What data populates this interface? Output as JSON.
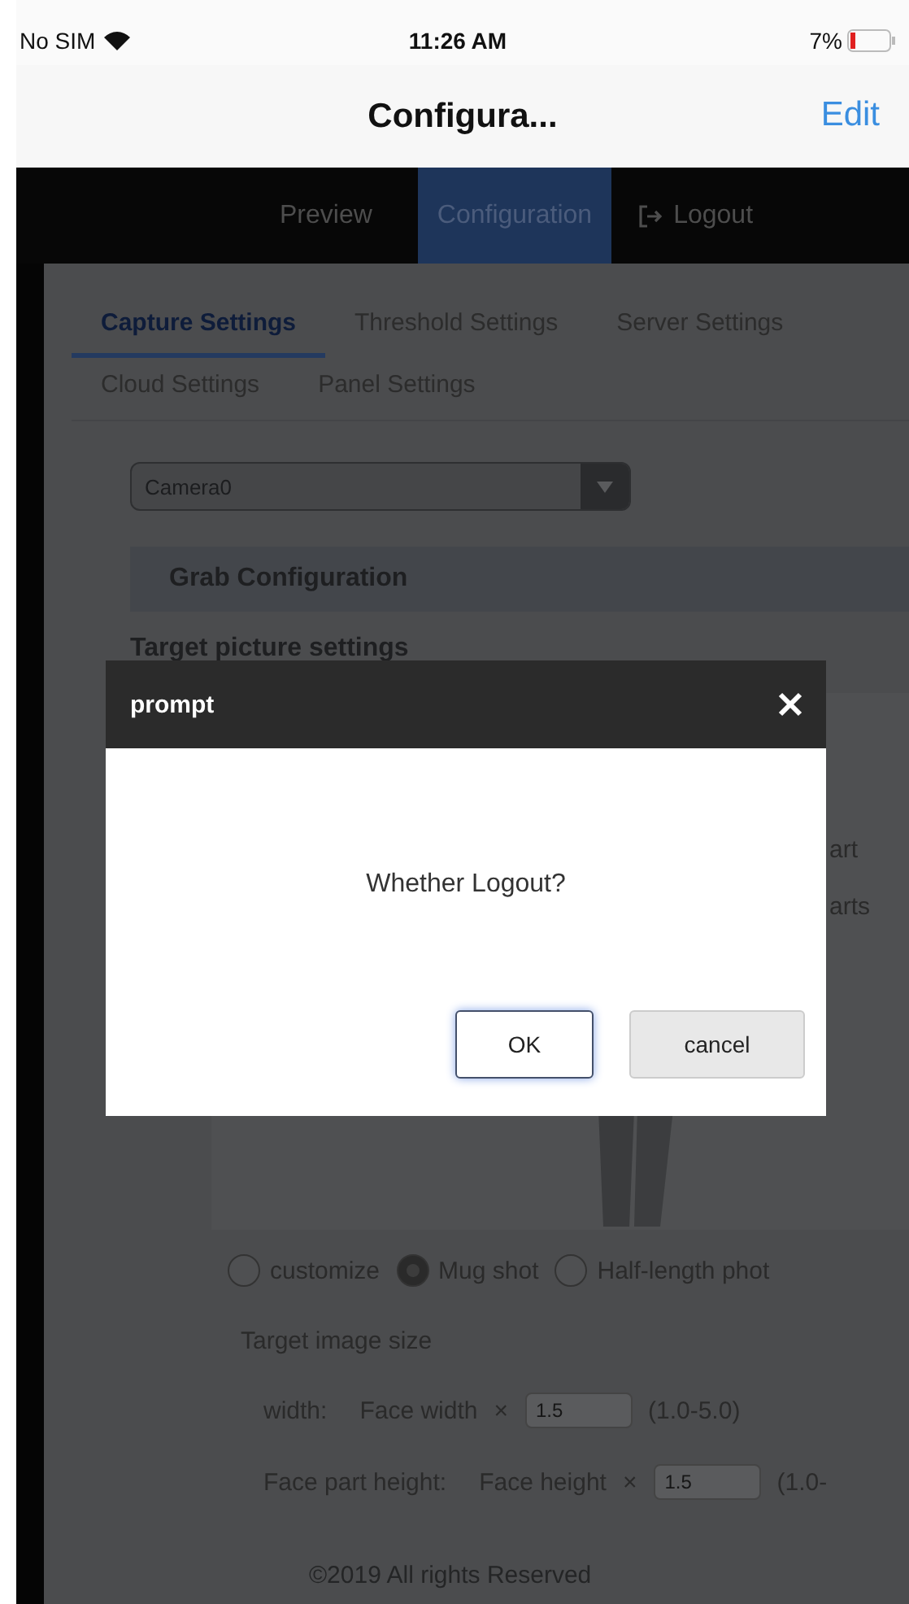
{
  "status_bar": {
    "carrier": "No SIM",
    "time": "11:26 AM",
    "battery": "7%"
  },
  "nav_bar": {
    "title": "Configura...",
    "action": "Edit"
  },
  "menu": [
    {
      "label": "Preview",
      "selected": false,
      "kind": "link"
    },
    {
      "label": "Configuration",
      "selected": true,
      "kind": "link"
    },
    {
      "label": "Logout",
      "selected": false,
      "kind": "logout"
    }
  ],
  "settings_tabs": [
    {
      "label": "Capture Settings",
      "selected": true
    },
    {
      "label": "Threshold Settings",
      "selected": false
    },
    {
      "label": "Server Settings",
      "selected": false
    },
    {
      "label": "Cloud Settings",
      "selected": false
    },
    {
      "label": "Panel Settings",
      "selected": false
    }
  ],
  "camera_select": {
    "value": "Camera0"
  },
  "section_title": "Grab Configuration",
  "subsection_title": "Target picture settings",
  "side_labels": [
    "art",
    "arts"
  ],
  "shot_types": [
    {
      "label": "customize",
      "selected": false
    },
    {
      "label": "Mug shot",
      "selected": true
    },
    {
      "label": "Half-length phot",
      "selected": false
    }
  ],
  "size_title": "Target image size",
  "size_rows": [
    {
      "label": "width:",
      "factor": "Face width",
      "times": "×",
      "value": "1.5",
      "range": "(1.0-5.0)"
    },
    {
      "label": "Face part height:",
      "factor": "Face height",
      "times": "×",
      "value": "1.5",
      "range": "(1.0-"
    }
  ],
  "footer": "©2019 All rights Reserved",
  "dialog": {
    "title": "prompt",
    "message": "Whether Logout?",
    "buttons": [
      {
        "label": "OK",
        "kind": "primary"
      },
      {
        "label": "cancel",
        "kind": "secondary"
      }
    ]
  }
}
